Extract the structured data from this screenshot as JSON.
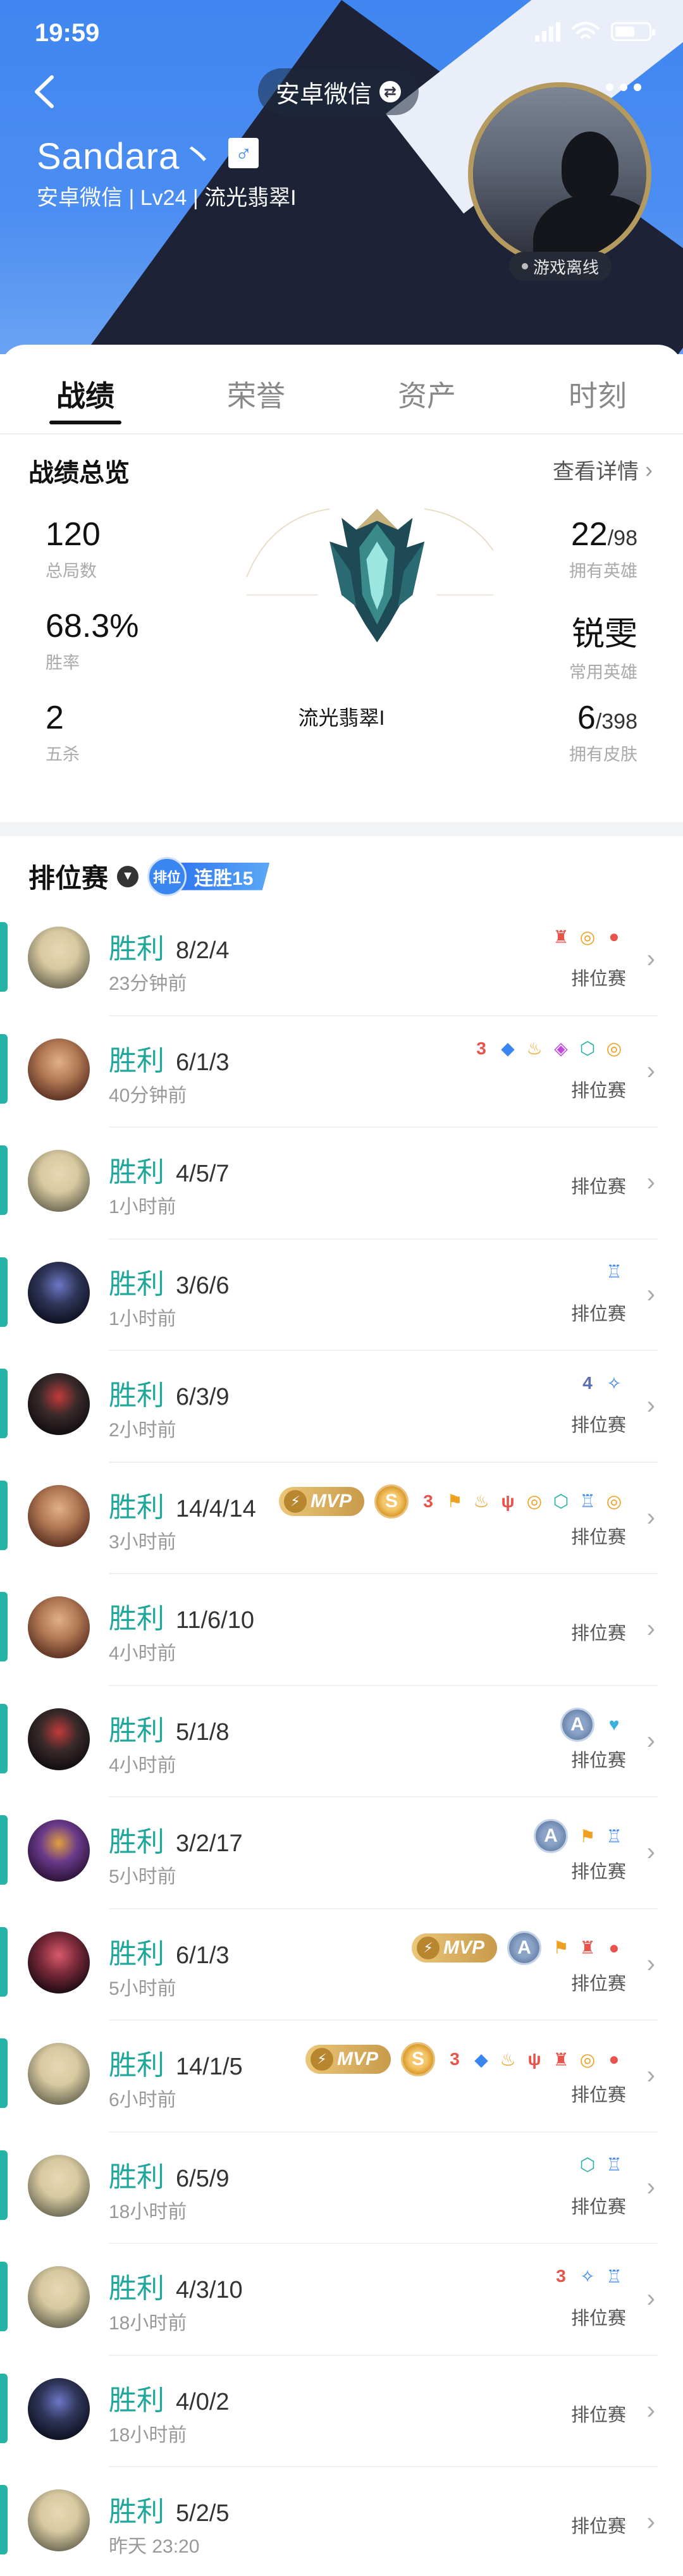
{
  "status": {
    "time": "19:59"
  },
  "header": {
    "switch_label": "安卓微信",
    "username": "Sandara丶",
    "gender_symbol": "♂",
    "subinfo": "安卓微信 | Lv24 | 流光翡翠I",
    "offline_label": "游戏离线"
  },
  "tabs": [
    {
      "label": "战绩"
    },
    {
      "label": "荣誉"
    },
    {
      "label": "资产"
    },
    {
      "label": "时刻"
    }
  ],
  "overview": {
    "title": "战绩总览",
    "detail_link": "查看详情",
    "rank_name": "流光翡翠I",
    "left_stats": [
      {
        "value": "120",
        "label": "总局数"
      },
      {
        "value": "68.3%",
        "label": "胜率"
      },
      {
        "value": "2",
        "label": "五杀"
      }
    ],
    "right_stats": [
      {
        "value": "22",
        "suffix": "/98",
        "label": "拥有英雄"
      },
      {
        "value": "锐雯",
        "suffix": "",
        "label": "常用英雄"
      },
      {
        "value": "6",
        "suffix": "/398",
        "label": "拥有皮肤"
      }
    ]
  },
  "ranked": {
    "title": "排位赛",
    "badge_chip": "排位",
    "streak_label": "连胜15"
  },
  "colors": {
    "win": "#1fa79a",
    "accent_bar": "#23b4a6",
    "header_blue": "#3f86f0"
  },
  "matches": [
    {
      "result": "胜利",
      "kda": "8/2/4",
      "time": "23分钟前",
      "mode": "排位赛",
      "hero": "riven",
      "mvp": false,
      "grade": "",
      "icons": [
        "tower-icon",
        "coins-icon",
        "blood-drop-icon"
      ]
    },
    {
      "result": "胜利",
      "kda": "6/1/3",
      "time": "40分钟前",
      "mode": "排位赛",
      "hero": "sorceress",
      "mvp": false,
      "grade": "",
      "icons": [
        "triple-kill-icon",
        "dragon-icon",
        "fire-icon",
        "baron-icon",
        "shield-icon",
        "coins-icon"
      ]
    },
    {
      "result": "胜利",
      "kda": "4/5/7",
      "time": "1小时前",
      "mode": "排位赛",
      "hero": "riven",
      "mvp": false,
      "grade": "",
      "icons": []
    },
    {
      "result": "胜利",
      "kda": "3/6/6",
      "time": "1小时前",
      "mode": "排位赛",
      "hero": "dark-knight",
      "mvp": false,
      "grade": "",
      "icons": [
        "ward-icon"
      ]
    },
    {
      "result": "胜利",
      "kda": "6/3/9",
      "time": "2小时前",
      "mode": "排位赛",
      "hero": "shadow-warrior",
      "mvp": false,
      "grade": "",
      "icons": [
        "quadra-kill-icon",
        "vision-icon"
      ]
    },
    {
      "result": "胜利",
      "kda": "14/4/14",
      "time": "3小时前",
      "mode": "排位赛",
      "hero": "sorceress",
      "mvp": true,
      "mvp_label": "MVP",
      "grade": "S",
      "icons": [
        "triple-kill-icon",
        "flag-icon",
        "fire-icon",
        "claw-icon",
        "coins-icon",
        "shield-icon",
        "ward-icon",
        "coins-icon"
      ]
    },
    {
      "result": "胜利",
      "kda": "11/6/10",
      "time": "4小时前",
      "mode": "排位赛",
      "hero": "sorceress",
      "mvp": false,
      "grade": "",
      "icons": []
    },
    {
      "result": "胜利",
      "kda": "5/1/8",
      "time": "4小时前",
      "mode": "排位赛",
      "hero": "shadow-warrior",
      "mvp": false,
      "grade": "A",
      "icons": [
        "heart-icon"
      ]
    },
    {
      "result": "胜利",
      "kda": "3/2/17",
      "time": "5小时前",
      "mode": "排位赛",
      "hero": "imp",
      "mvp": false,
      "grade": "A",
      "icons": [
        "flag-icon",
        "ward-icon"
      ]
    },
    {
      "result": "胜利",
      "kda": "6/1/3",
      "time": "5小时前",
      "mode": "排位赛",
      "hero": "vampire",
      "mvp": true,
      "mvp_label": "MVP",
      "grade": "A",
      "icons": [
        "flag-icon",
        "tower-icon",
        "blood-drop-icon"
      ]
    },
    {
      "result": "胜利",
      "kda": "14/1/5",
      "time": "6小时前",
      "mode": "排位赛",
      "hero": "riven",
      "mvp": true,
      "mvp_label": "MVP",
      "grade": "S",
      "icons": [
        "triple-kill-icon",
        "dragon-icon",
        "fire-icon",
        "claw-icon",
        "tower-icon",
        "coins-icon",
        "blood-drop-icon"
      ]
    },
    {
      "result": "胜利",
      "kda": "6/5/9",
      "time": "18小时前",
      "mode": "排位赛",
      "hero": "riven",
      "mvp": false,
      "grade": "",
      "icons": [
        "shield-icon",
        "ward-icon"
      ]
    },
    {
      "result": "胜利",
      "kda": "4/3/10",
      "time": "18小时前",
      "mode": "排位赛",
      "hero": "riven",
      "mvp": false,
      "grade": "",
      "icons": [
        "triple-kill-icon",
        "vision-icon",
        "ward-icon"
      ]
    },
    {
      "result": "胜利",
      "kda": "4/0/2",
      "time": "18小时前",
      "mode": "排位赛",
      "hero": "dark-knight",
      "mvp": false,
      "grade": "",
      "icons": []
    },
    {
      "result": "胜利",
      "kda": "5/2/5",
      "time": "昨天 23:20",
      "mode": "排位赛",
      "hero": "riven",
      "mvp": false,
      "grade": "",
      "icons": []
    }
  ]
}
